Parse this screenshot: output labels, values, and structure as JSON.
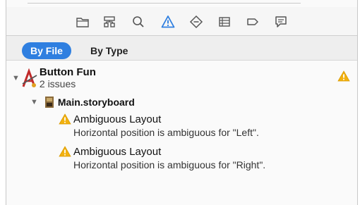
{
  "toolbar": {
    "icons": [
      "folder-icon",
      "hierarchy-icon",
      "search-icon",
      "warning-icon",
      "diamond-icon",
      "list-icon",
      "tag-icon",
      "message-icon"
    ],
    "active_color": "#2f7fe0"
  },
  "filter": {
    "by_file": "By File",
    "by_type": "By Type"
  },
  "project": {
    "name": "Button Fun",
    "issue_count": "2 issues"
  },
  "file": {
    "name": "Main.storyboard"
  },
  "issues": [
    {
      "title": "Ambiguous Layout",
      "description": "Horizontal position is ambiguous for \"Left\"."
    },
    {
      "title": "Ambiguous Layout",
      "description": "Horizontal position is ambiguous for \"Right\"."
    }
  ],
  "colors": {
    "warning": "#f2b10f",
    "accent": "#2f7fe0"
  }
}
